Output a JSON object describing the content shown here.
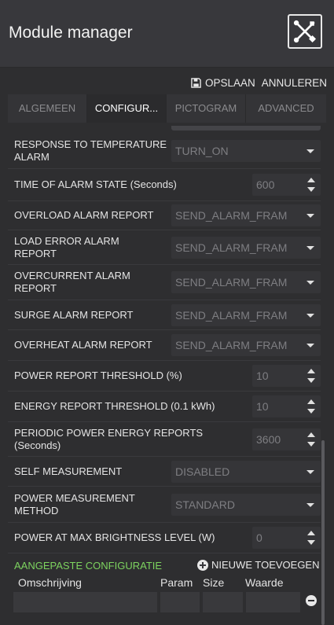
{
  "header": {
    "title": "Module manager",
    "logo_icon": "tools-cross-icon"
  },
  "actions": {
    "save_label": "OPSLAAN",
    "cancel_label": "ANNULEREN",
    "save_icon": "floppy-disk-icon"
  },
  "tabs": [
    {
      "label": "ALGEMEEN",
      "active": false
    },
    {
      "label": "CONFIGUR...",
      "active": true
    },
    {
      "label": "PICTOGRAM",
      "active": false
    },
    {
      "label": "ADVANCED",
      "active": false
    }
  ],
  "settings": [
    {
      "label": "RESPONSE TO TEMPERATURE ALARM",
      "type": "select",
      "value": "TURN_ON"
    },
    {
      "label": "TIME OF ALARM STATE (Seconds)",
      "type": "number",
      "value": "600"
    },
    {
      "label": "OVERLOAD ALARM REPORT",
      "type": "select",
      "value": "SEND_ALARM_FRAM"
    },
    {
      "label": "LOAD ERROR ALARM REPORT",
      "type": "select",
      "value": "SEND_ALARM_FRAM"
    },
    {
      "label": "OVERCURRENT ALARM REPORT",
      "type": "select",
      "value": "SEND_ALARM_FRAM"
    },
    {
      "label": "SURGE ALARM REPORT",
      "type": "select",
      "value": "SEND_ALARM_FRAM"
    },
    {
      "label": "OVERHEAT ALARM REPORT",
      "type": "select",
      "value": "SEND_ALARM_FRAM"
    },
    {
      "label": "POWER REPORT THRESHOLD (%)",
      "type": "number",
      "value": "10"
    },
    {
      "label": "ENERGY REPORT THRESHOLD (0.1 kWh)",
      "type": "number",
      "value": "10"
    },
    {
      "label": "PERIODIC POWER ENERGY REPORTS (Seconds)",
      "type": "number",
      "value": "3600"
    },
    {
      "label": "SELF MEASUREMENT",
      "type": "select",
      "value": "DISABLED"
    },
    {
      "label": "POWER MEASUREMENT METHOD",
      "type": "select",
      "value": "STANDARD"
    },
    {
      "label": "POWER AT MAX BRIGHTNESS LEVEL (W)",
      "type": "number",
      "value": "0"
    }
  ],
  "custom": {
    "title": "AANGEPASTE CONFIGURATIE",
    "add_label": "NIEUWE TOEVOEGEN",
    "columns": [
      "Omschrijving",
      "Param",
      "Size",
      "Waarde"
    ],
    "accent_color": "#7dd35f"
  }
}
